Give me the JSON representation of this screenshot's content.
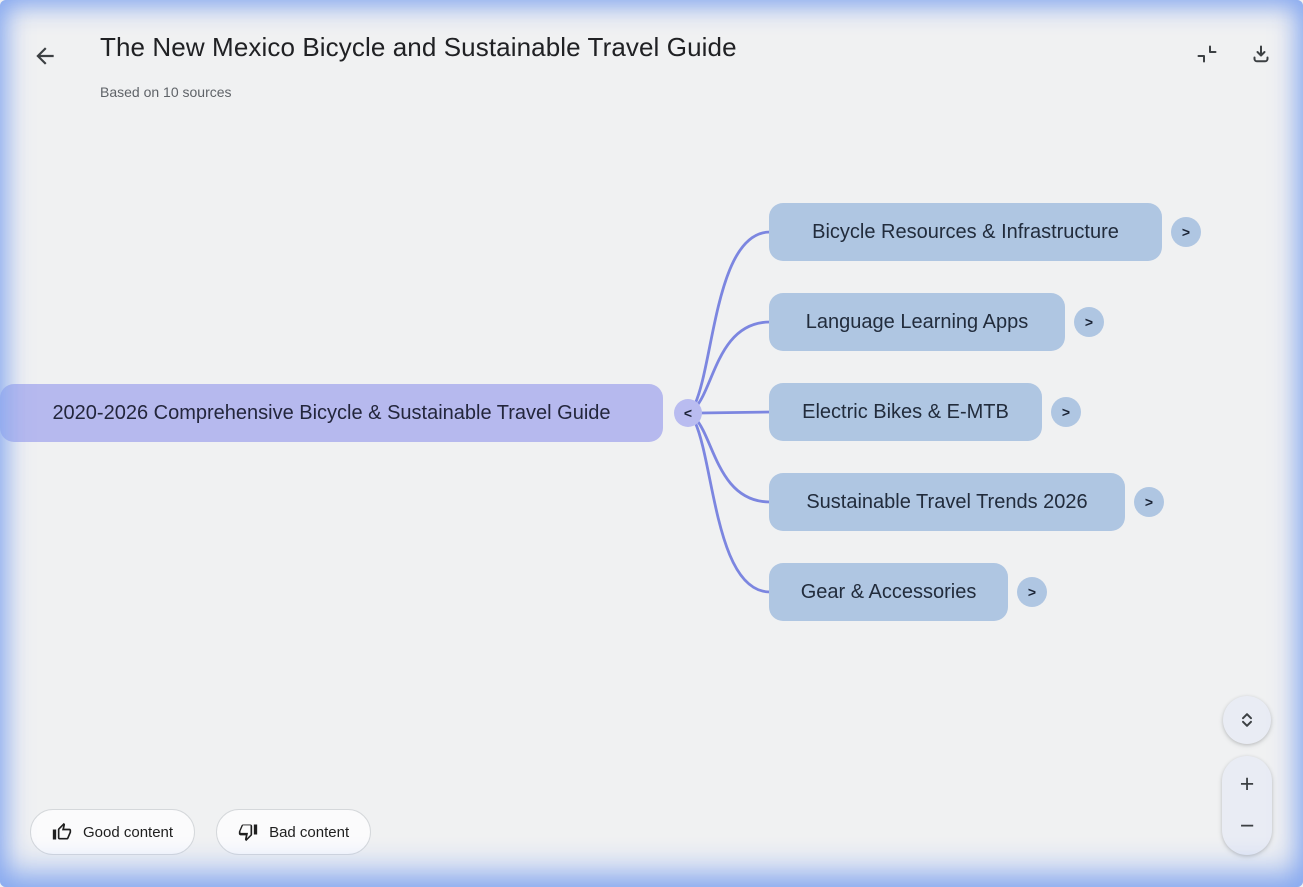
{
  "header": {
    "title": "The New Mexico Bicycle and Sustainable Travel Guide",
    "subtitle": "Based on 10 sources"
  },
  "mindmap": {
    "root": {
      "label": "2020-2026 Comprehensive Bicycle & Sustainable Travel Guide",
      "collapse_glyph": "<"
    },
    "children": [
      {
        "label": "Bicycle Resources & Infrastructure",
        "expand_glyph": ">"
      },
      {
        "label": "Language Learning Apps",
        "expand_glyph": ">"
      },
      {
        "label": "Electric Bikes & E-MTB",
        "expand_glyph": ">"
      },
      {
        "label": "Sustainable Travel Trends 2026",
        "expand_glyph": ">"
      },
      {
        "label": "Gear & Accessories",
        "expand_glyph": ">"
      }
    ],
    "colors": {
      "root_fill": "#b6b9ee",
      "child_fill": "#afc6e2",
      "edge": "#7c86e0",
      "background": "#f0f1f2",
      "frame_glow": "#88aaf0"
    }
  },
  "feedback": {
    "good_label": "Good content",
    "bad_label": "Bad content"
  },
  "controls": {
    "zoom_in_label": "+",
    "zoom_out_label": "−"
  }
}
